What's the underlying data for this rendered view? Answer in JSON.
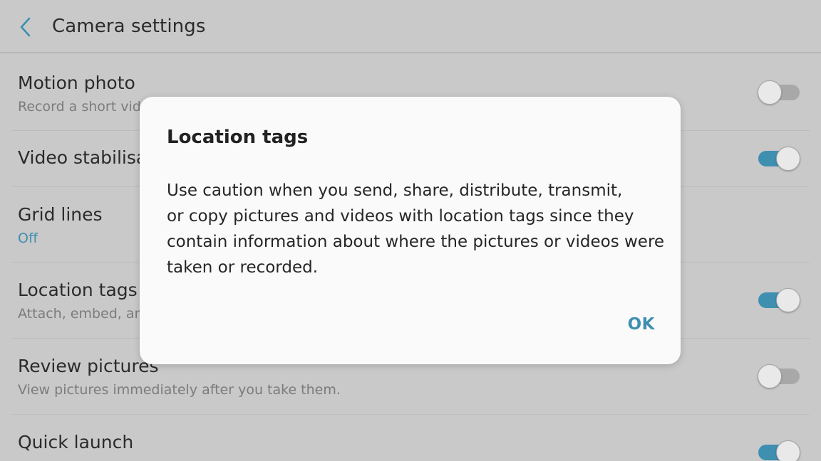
{
  "header": {
    "title": "Camera settings",
    "back_icon": "chevron-left-icon"
  },
  "colors": {
    "accent": "#3f8fb1",
    "background": "#c9c9c9",
    "dialog_background": "#fafafa"
  },
  "settings": [
    {
      "title": "Motion photo",
      "subtitle": "Record a short vide",
      "toggle": "off"
    },
    {
      "title": "Video stabilisa",
      "subtitle": "",
      "toggle": "on"
    },
    {
      "title": "Grid lines",
      "subtitle": "Off",
      "toggle": null
    },
    {
      "title": "Location tags",
      "subtitle": "Attach, embed, and",
      "toggle": "on"
    },
    {
      "title": "Review pictures",
      "subtitle": "View pictures immediately after you take them.",
      "toggle": "off"
    },
    {
      "title": "Quick launch",
      "subtitle": "",
      "toggle": "on"
    }
  ],
  "dialog": {
    "title": "Location tags",
    "body_lines": [
      "Use caution when you send, share, distribute, transmit,",
      "or copy pictures and videos with location tags since they",
      "contain information about where the pictures or videos were",
      "taken or recorded."
    ],
    "ok_label": "OK"
  }
}
